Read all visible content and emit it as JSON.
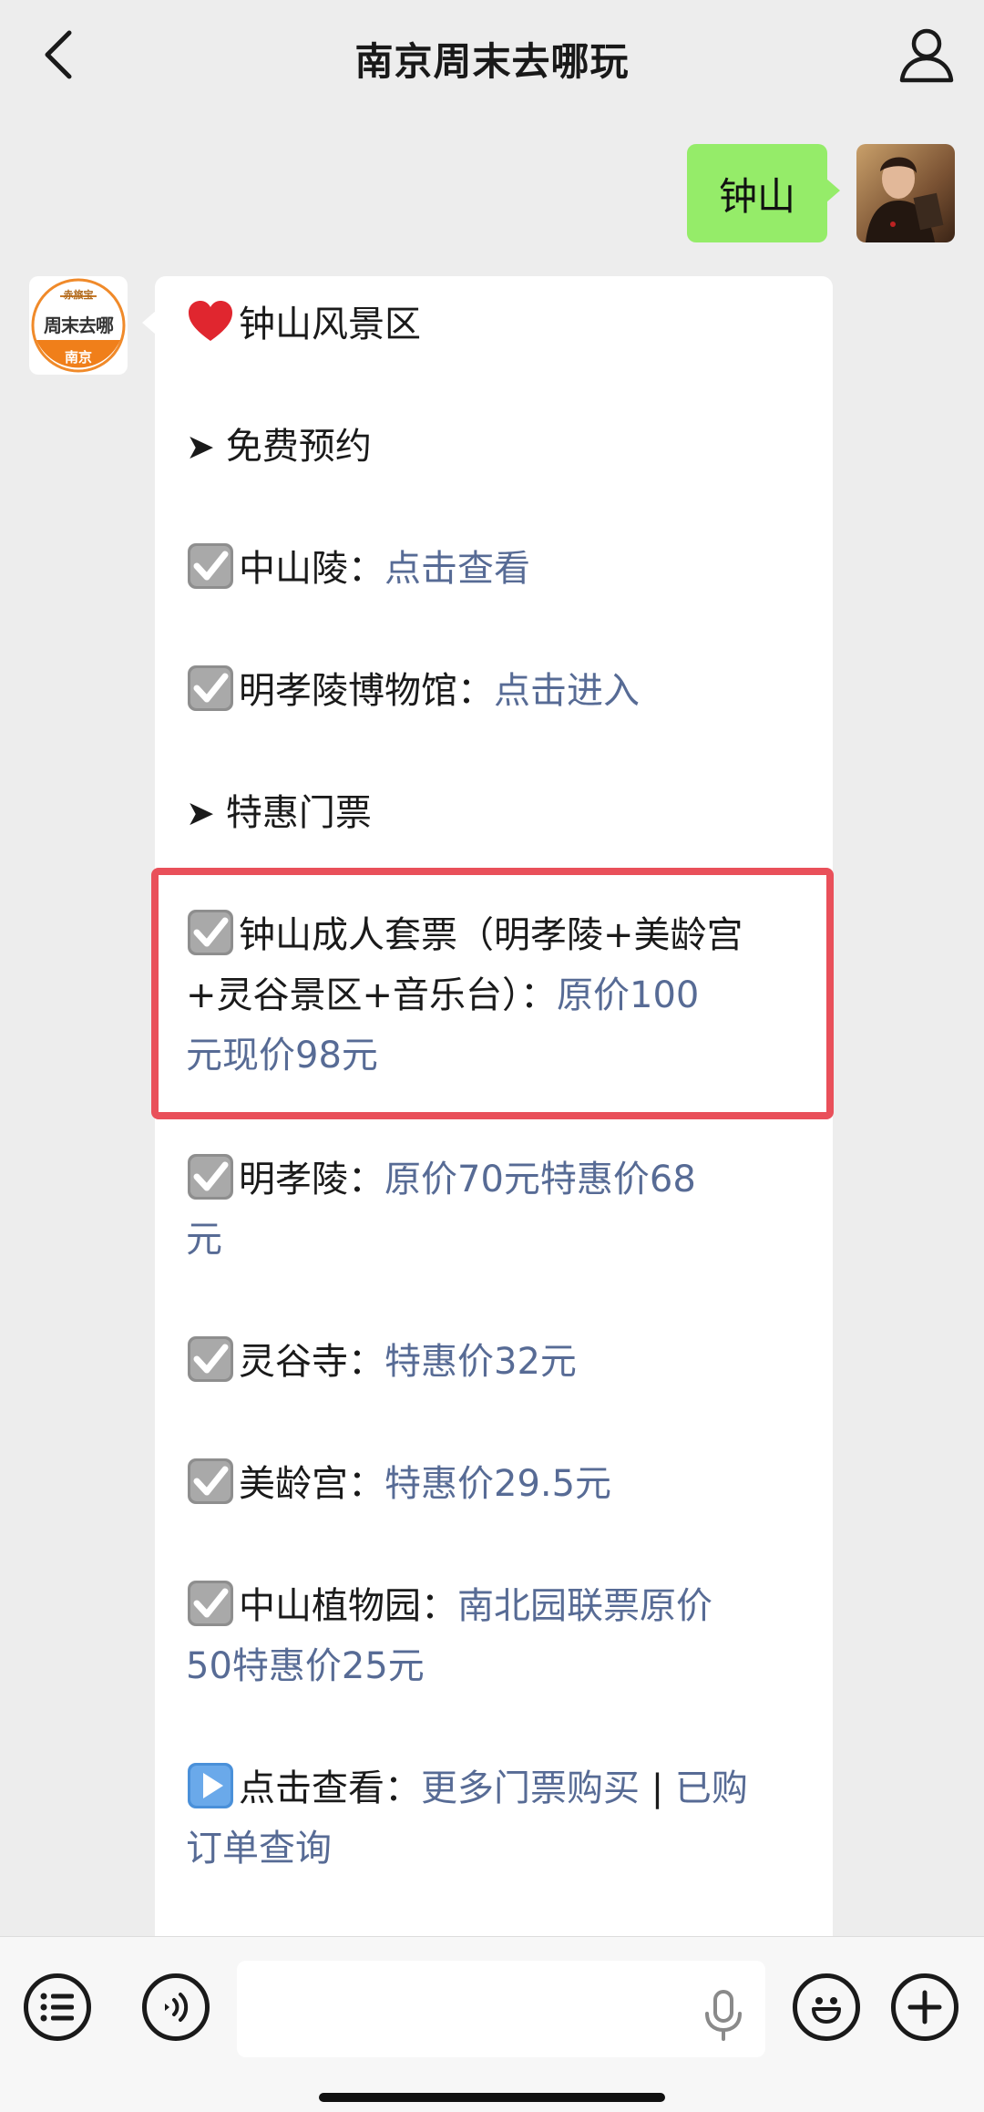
{
  "header": {
    "title": "南京周末去哪玩"
  },
  "outgoing": {
    "text": "钟山"
  },
  "bot_avatar": {
    "top": "赤旅宝",
    "middle": "周末去哪",
    "bottom": "南京"
  },
  "message": {
    "title": "钟山风景区",
    "section_free": "免费预约",
    "item1_label": "中山陵：",
    "item1_link": "点击查看",
    "item2_label": "明孝陵博物馆：",
    "item2_link": "点击进入",
    "section_discount": "特惠门票",
    "package_label_l1": "钟山成人套票（明孝陵+美龄宫",
    "package_label_l2": "+灵谷景区+音乐台）：",
    "package_link_l2": "原价100",
    "package_link_l3": "元现价98元",
    "mxl_label": "明孝陵：",
    "mxl_link_l1": "原价70元特惠价68",
    "mxl_link_l2": "元",
    "lgs_label": "灵谷寺：",
    "lgs_link": "特惠价32元",
    "mlg_label": "美龄宫：",
    "mlg_link": "特惠价29.5元",
    "zwy_label": "中山植物园：",
    "zwy_link_l1": "南北园联票原价",
    "zwy_link_l2": "50特惠价25元",
    "more_label": "点击查看：",
    "more_link1": "更多门票购买",
    "more_sep": " | ",
    "more_link2_l1": "已购",
    "more_link2_l2": "订单查询"
  },
  "icons": {
    "heart": "heart-icon",
    "checkbox": "checkbox-icon",
    "play": "play-button-icon",
    "arrow": "arrow-icon"
  },
  "colors": {
    "link": "#576b95",
    "my_bubble": "#95ec69",
    "highlight": "#e9505a"
  }
}
